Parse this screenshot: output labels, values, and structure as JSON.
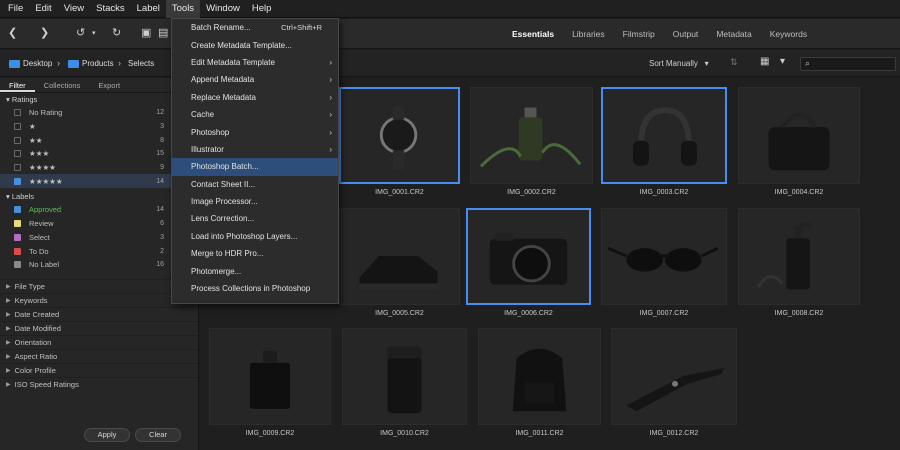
{
  "menubar": [
    "File",
    "Edit",
    "View",
    "Stacks",
    "Label",
    "Tools",
    "Window",
    "Help"
  ],
  "menubar_active": "Tools",
  "workspace_tabs": [
    "Essentials",
    "Libraries",
    "Filmstrip",
    "Output",
    "Metadata",
    "Keywords"
  ],
  "workspace_active": "Essentials",
  "breadcrumb": [
    "Desktop",
    "Products",
    "Selects"
  ],
  "sort_label": "Sort Manually",
  "panel_tabs": [
    "Filter",
    "Collections",
    "Export"
  ],
  "ratings": {
    "title": "Ratings",
    "items": [
      {
        "label": "No Rating",
        "count": "12",
        "checked": false
      },
      {
        "label": "★",
        "count": "3",
        "checked": false
      },
      {
        "label": "★★",
        "count": "8",
        "checked": false
      },
      {
        "label": "★★★",
        "count": "15",
        "checked": false
      },
      {
        "label": "★★★★",
        "count": "9",
        "checked": false
      },
      {
        "label": "★★★★★",
        "count": "14",
        "checked": true
      }
    ]
  },
  "labels": {
    "title": "Labels",
    "items": [
      {
        "label": "Approved",
        "count": "14",
        "color": "#5bbf5b",
        "checked": true
      },
      {
        "label": "Review",
        "count": "6",
        "color": "#e8d97a",
        "checked": false
      },
      {
        "label": "Select",
        "count": "3",
        "color": "#b76cc4",
        "checked": false
      },
      {
        "label": "To Do",
        "count": "2",
        "color": "#d84c4c",
        "checked": false
      },
      {
        "label": "No Label",
        "count": "16",
        "color": "#8a8a8a",
        "checked": false
      }
    ]
  },
  "collapsed_sections": [
    "File Type",
    "Keywords",
    "Date Created",
    "Date Modified",
    "Orientation",
    "Aspect Ratio",
    "Color Profile",
    "ISO Speed Ratings"
  ],
  "buttons": {
    "apply": "Apply",
    "clear": "Clear"
  },
  "thumbnails": [
    {
      "name": "IMG_0001.CR2",
      "selected": true
    },
    {
      "name": "IMG_0002.CR2",
      "selected": false
    },
    {
      "name": "IMG_0003.CR2",
      "selected": true
    },
    {
      "name": "IMG_0004.CR2",
      "selected": false
    },
    {
      "name": "IMG_0005.CR2",
      "selected": false
    },
    {
      "name": "IMG_0006.CR2",
      "selected": true
    },
    {
      "name": "IMG_0007.CR2",
      "selected": false
    },
    {
      "name": "IMG_0008.CR2",
      "selected": false
    },
    {
      "name": "IMG_0009.CR2",
      "selected": false
    },
    {
      "name": "IMG_0010.CR2",
      "selected": false
    },
    {
      "name": "IMG_0011.CR2",
      "selected": false
    },
    {
      "name": "IMG_0012.CR2",
      "selected": false
    }
  ],
  "tools_menu": [
    {
      "label": "Batch Rename...",
      "shortcut": "Ctrl+Shift+R",
      "submenu": false,
      "highlighted": false
    },
    {
      "label": "Create Metadata Template...",
      "shortcut": "",
      "submenu": false,
      "highlighted": false
    },
    {
      "label": "Edit Metadata Template",
      "shortcut": "",
      "submenu": true,
      "highlighted": false
    },
    {
      "label": "Append Metadata",
      "shortcut": "",
      "submenu": true,
      "highlighted": false
    },
    {
      "label": "Replace Metadata",
      "shortcut": "",
      "submenu": true,
      "highlighted": false
    },
    {
      "label": "Cache",
      "shortcut": "",
      "submenu": true,
      "highlighted": false
    },
    {
      "label": "Photoshop",
      "shortcut": "",
      "submenu": true,
      "highlighted": false
    },
    {
      "label": "Illustrator",
      "shortcut": "",
      "submenu": true,
      "highlighted": false
    },
    {
      "label": "Photoshop Batch...",
      "shortcut": "",
      "submenu": false,
      "highlighted": true
    },
    {
      "label": "Contact Sheet II...",
      "shortcut": "",
      "submenu": false,
      "highlighted": false
    },
    {
      "label": "Image Processor...",
      "shortcut": "",
      "submenu": false,
      "highlighted": false
    },
    {
      "label": "Lens Correction...",
      "shortcut": "",
      "submenu": false,
      "highlighted": false
    },
    {
      "label": "Load into Photoshop Layers...",
      "shortcut": "",
      "submenu": false,
      "highlighted": false
    },
    {
      "label": "Merge to HDR Pro...",
      "shortcut": "",
      "submenu": false,
      "highlighted": false
    },
    {
      "label": "Photomerge...",
      "shortcut": "",
      "submenu": false,
      "highlighted": false
    },
    {
      "label": "Process Collections in Photoshop",
      "shortcut": "",
      "submenu": false,
      "highlighted": false
    }
  ]
}
